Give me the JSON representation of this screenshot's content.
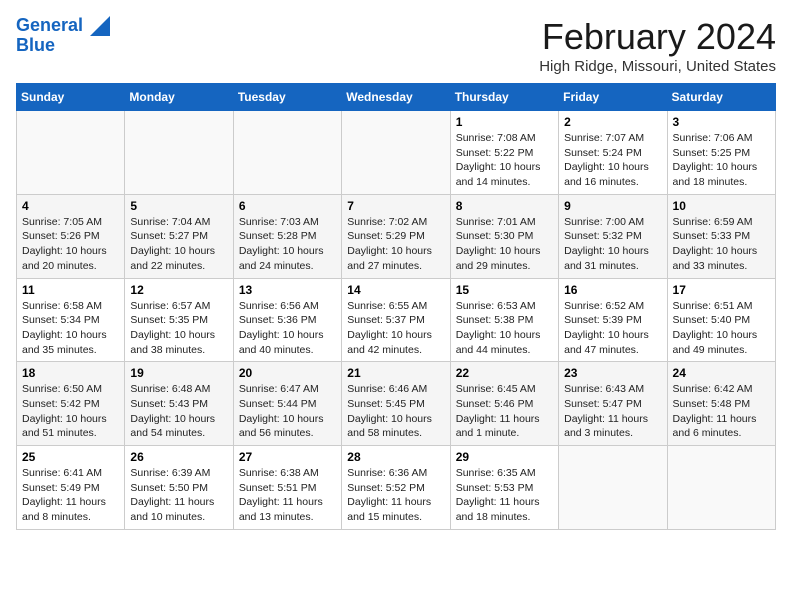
{
  "header": {
    "logo_line1": "General",
    "logo_line2": "Blue",
    "month": "February 2024",
    "location": "High Ridge, Missouri, United States"
  },
  "weekdays": [
    "Sunday",
    "Monday",
    "Tuesday",
    "Wednesday",
    "Thursday",
    "Friday",
    "Saturday"
  ],
  "weeks": [
    [
      {
        "day": "",
        "info": ""
      },
      {
        "day": "",
        "info": ""
      },
      {
        "day": "",
        "info": ""
      },
      {
        "day": "",
        "info": ""
      },
      {
        "day": "1",
        "info": "Sunrise: 7:08 AM\nSunset: 5:22 PM\nDaylight: 10 hours\nand 14 minutes."
      },
      {
        "day": "2",
        "info": "Sunrise: 7:07 AM\nSunset: 5:24 PM\nDaylight: 10 hours\nand 16 minutes."
      },
      {
        "day": "3",
        "info": "Sunrise: 7:06 AM\nSunset: 5:25 PM\nDaylight: 10 hours\nand 18 minutes."
      }
    ],
    [
      {
        "day": "4",
        "info": "Sunrise: 7:05 AM\nSunset: 5:26 PM\nDaylight: 10 hours\nand 20 minutes."
      },
      {
        "day": "5",
        "info": "Sunrise: 7:04 AM\nSunset: 5:27 PM\nDaylight: 10 hours\nand 22 minutes."
      },
      {
        "day": "6",
        "info": "Sunrise: 7:03 AM\nSunset: 5:28 PM\nDaylight: 10 hours\nand 24 minutes."
      },
      {
        "day": "7",
        "info": "Sunrise: 7:02 AM\nSunset: 5:29 PM\nDaylight: 10 hours\nand 27 minutes."
      },
      {
        "day": "8",
        "info": "Sunrise: 7:01 AM\nSunset: 5:30 PM\nDaylight: 10 hours\nand 29 minutes."
      },
      {
        "day": "9",
        "info": "Sunrise: 7:00 AM\nSunset: 5:32 PM\nDaylight: 10 hours\nand 31 minutes."
      },
      {
        "day": "10",
        "info": "Sunrise: 6:59 AM\nSunset: 5:33 PM\nDaylight: 10 hours\nand 33 minutes."
      }
    ],
    [
      {
        "day": "11",
        "info": "Sunrise: 6:58 AM\nSunset: 5:34 PM\nDaylight: 10 hours\nand 35 minutes."
      },
      {
        "day": "12",
        "info": "Sunrise: 6:57 AM\nSunset: 5:35 PM\nDaylight: 10 hours\nand 38 minutes."
      },
      {
        "day": "13",
        "info": "Sunrise: 6:56 AM\nSunset: 5:36 PM\nDaylight: 10 hours\nand 40 minutes."
      },
      {
        "day": "14",
        "info": "Sunrise: 6:55 AM\nSunset: 5:37 PM\nDaylight: 10 hours\nand 42 minutes."
      },
      {
        "day": "15",
        "info": "Sunrise: 6:53 AM\nSunset: 5:38 PM\nDaylight: 10 hours\nand 44 minutes."
      },
      {
        "day": "16",
        "info": "Sunrise: 6:52 AM\nSunset: 5:39 PM\nDaylight: 10 hours\nand 47 minutes."
      },
      {
        "day": "17",
        "info": "Sunrise: 6:51 AM\nSunset: 5:40 PM\nDaylight: 10 hours\nand 49 minutes."
      }
    ],
    [
      {
        "day": "18",
        "info": "Sunrise: 6:50 AM\nSunset: 5:42 PM\nDaylight: 10 hours\nand 51 minutes."
      },
      {
        "day": "19",
        "info": "Sunrise: 6:48 AM\nSunset: 5:43 PM\nDaylight: 10 hours\nand 54 minutes."
      },
      {
        "day": "20",
        "info": "Sunrise: 6:47 AM\nSunset: 5:44 PM\nDaylight: 10 hours\nand 56 minutes."
      },
      {
        "day": "21",
        "info": "Sunrise: 6:46 AM\nSunset: 5:45 PM\nDaylight: 10 hours\nand 58 minutes."
      },
      {
        "day": "22",
        "info": "Sunrise: 6:45 AM\nSunset: 5:46 PM\nDaylight: 11 hours\nand 1 minute."
      },
      {
        "day": "23",
        "info": "Sunrise: 6:43 AM\nSunset: 5:47 PM\nDaylight: 11 hours\nand 3 minutes."
      },
      {
        "day": "24",
        "info": "Sunrise: 6:42 AM\nSunset: 5:48 PM\nDaylight: 11 hours\nand 6 minutes."
      }
    ],
    [
      {
        "day": "25",
        "info": "Sunrise: 6:41 AM\nSunset: 5:49 PM\nDaylight: 11 hours\nand 8 minutes."
      },
      {
        "day": "26",
        "info": "Sunrise: 6:39 AM\nSunset: 5:50 PM\nDaylight: 11 hours\nand 10 minutes."
      },
      {
        "day": "27",
        "info": "Sunrise: 6:38 AM\nSunset: 5:51 PM\nDaylight: 11 hours\nand 13 minutes."
      },
      {
        "day": "28",
        "info": "Sunrise: 6:36 AM\nSunset: 5:52 PM\nDaylight: 11 hours\nand 15 minutes."
      },
      {
        "day": "29",
        "info": "Sunrise: 6:35 AM\nSunset: 5:53 PM\nDaylight: 11 hours\nand 18 minutes."
      },
      {
        "day": "",
        "info": ""
      },
      {
        "day": "",
        "info": ""
      }
    ]
  ]
}
